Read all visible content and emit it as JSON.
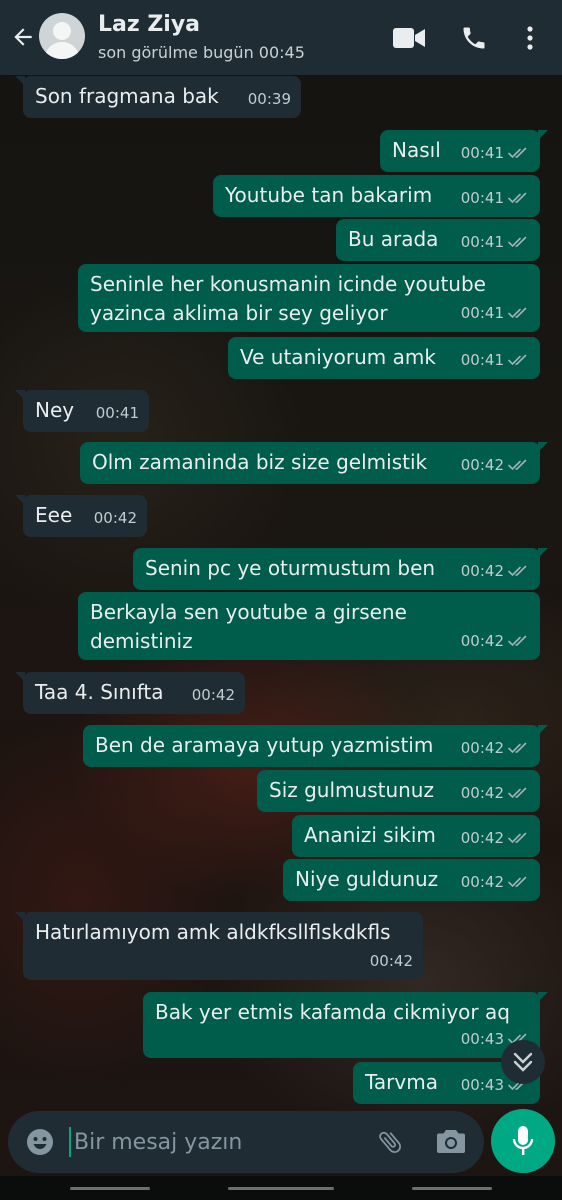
{
  "header": {
    "contact_name": "Laz Ziya",
    "status": "son görülme bugün 00:45",
    "icons": [
      "back-arrow-icon",
      "avatar",
      "video-call-icon",
      "phone-call-icon",
      "more-options-icon"
    ]
  },
  "messages": [
    {
      "dir": "in",
      "lines": [
        "Son fragmana bak"
      ],
      "time": "00:39"
    },
    {
      "dir": "out",
      "lines": [
        "Nasıl"
      ],
      "time": "00:41",
      "read": true
    },
    {
      "dir": "out",
      "lines": [
        "Youtube tan bakarim"
      ],
      "time": "00:41",
      "read": true
    },
    {
      "dir": "out",
      "lines": [
        "Bu arada"
      ],
      "time": "00:41",
      "read": true
    },
    {
      "dir": "out",
      "lines": [
        "Seninle her konusmanin icinde youtube",
        "yazinca aklima bir sey geliyor"
      ],
      "time": "00:41",
      "read": true
    },
    {
      "dir": "out",
      "lines": [
        "Ve utaniyorum amk"
      ],
      "time": "00:41",
      "read": true
    },
    {
      "dir": "in",
      "lines": [
        "Ney"
      ],
      "time": "00:41"
    },
    {
      "dir": "out",
      "lines": [
        "Olm zamaninda biz size gelmistik"
      ],
      "time": "00:42",
      "read": true
    },
    {
      "dir": "in",
      "lines": [
        "Eee"
      ],
      "time": "00:42"
    },
    {
      "dir": "out",
      "lines": [
        "Senin pc ye oturmustum ben"
      ],
      "time": "00:42",
      "read": true
    },
    {
      "dir": "out",
      "lines": [
        "Berkayla sen youtube a girsene",
        "demistiniz"
      ],
      "time": "00:42",
      "read": true
    },
    {
      "dir": "in",
      "lines": [
        "Taa 4. Sınıfta"
      ],
      "time": "00:42"
    },
    {
      "dir": "out",
      "lines": [
        "Ben de aramaya yutup yazmistim"
      ],
      "time": "00:42",
      "read": true
    },
    {
      "dir": "out",
      "lines": [
        "Siz gulmustunuz"
      ],
      "time": "00:42",
      "read": true
    },
    {
      "dir": "out",
      "lines": [
        "Ananizi sikim"
      ],
      "time": "00:42",
      "read": true
    },
    {
      "dir": "out",
      "lines": [
        "Niye guldunuz"
      ],
      "time": "00:42",
      "read": true
    },
    {
      "dir": "in",
      "lines": [
        "Hatırlamıyom amk aldkfksllflskdkfls"
      ],
      "time": "00:42"
    },
    {
      "dir": "out",
      "lines": [
        "Bak yer etmis kafamda cikmiyor aq"
      ],
      "time": "00:43",
      "read": true
    },
    {
      "dir": "out",
      "lines": [
        "Tarvma"
      ],
      "time": "00:43",
      "read": true
    }
  ],
  "composer": {
    "placeholder": "Bir mesaj yazın",
    "value": ""
  },
  "colors": {
    "header_bg": "#1f2c34",
    "incoming_bubble": "#1f2c34",
    "outgoing_bubble": "#005c4b",
    "read_ticks": "#9fb3bb",
    "accent": "#00a884"
  }
}
